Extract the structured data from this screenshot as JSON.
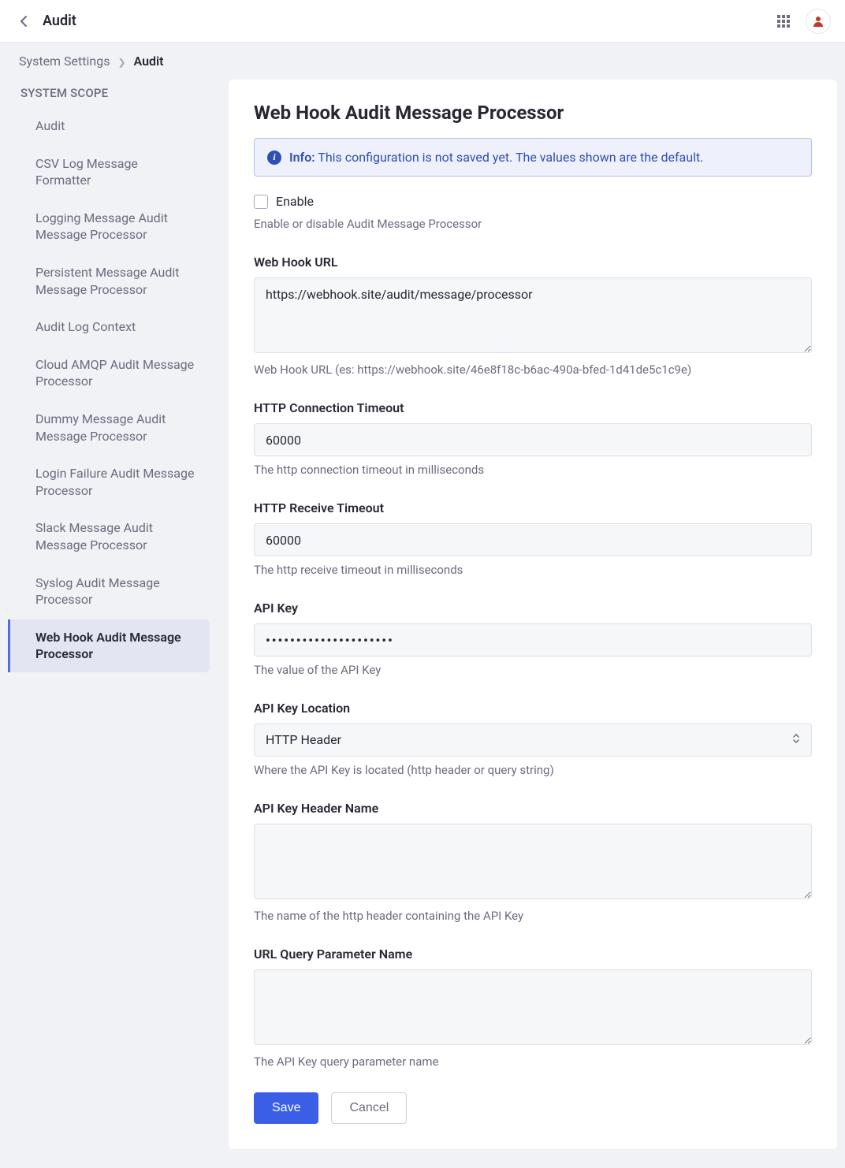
{
  "header": {
    "title": "Audit"
  },
  "breadcrumbs": {
    "root": "System Settings",
    "current": "Audit"
  },
  "sidebar": {
    "heading": "SYSTEM SCOPE",
    "items": [
      {
        "label": "Audit",
        "active": false
      },
      {
        "label": "CSV Log Message Formatter",
        "active": false
      },
      {
        "label": "Logging Message Audit Message Processor",
        "active": false
      },
      {
        "label": "Persistent Message Audit Message Processor",
        "active": false
      },
      {
        "label": "Audit Log Context",
        "active": false
      },
      {
        "label": "Cloud AMQP Audit Message Processor",
        "active": false
      },
      {
        "label": "Dummy Message Audit Message Processor",
        "active": false
      },
      {
        "label": "Login Failure Audit Message Processor",
        "active": false
      },
      {
        "label": "Slack Message Audit Message Processor",
        "active": false
      },
      {
        "label": "Syslog Audit Message Processor",
        "active": false
      },
      {
        "label": "Web Hook Audit Message Processor",
        "active": true
      }
    ]
  },
  "page": {
    "title": "Web Hook Audit Message Processor",
    "info": {
      "label": "Info:",
      "text": "This configuration is not saved yet. The values shown are the default."
    },
    "enable": {
      "label": "Enable",
      "checked": false,
      "help": "Enable or disable Audit Message Processor"
    },
    "fields": {
      "url": {
        "label": "Web Hook URL",
        "value": "https://webhook.site/audit/message/processor",
        "help": "Web Hook URL (es: https://webhook.site/46e8f18c-b6ac-490a-bfed-1d41de5c1c9e)"
      },
      "conn_timeout": {
        "label": "HTTP Connection Timeout",
        "value": "60000",
        "help": "The http connection timeout in milliseconds"
      },
      "recv_timeout": {
        "label": "HTTP Receive Timeout",
        "value": "60000",
        "help": "The http receive timeout in milliseconds"
      },
      "api_key": {
        "label": "API Key",
        "value": "•••••••••••••••••••••",
        "help": "The value of the API Key"
      },
      "api_key_loc": {
        "label": "API Key Location",
        "value": "HTTP Header",
        "help": "Where the API Key is located (http header or query string)"
      },
      "api_key_header": {
        "label": "API Key Header Name",
        "value": "",
        "help": "The name of the http header containing the API Key"
      },
      "url_query": {
        "label": "URL Query Parameter Name",
        "value": "",
        "help": "The API Key query parameter name"
      }
    },
    "actions": {
      "save": "Save",
      "cancel": "Cancel"
    }
  }
}
